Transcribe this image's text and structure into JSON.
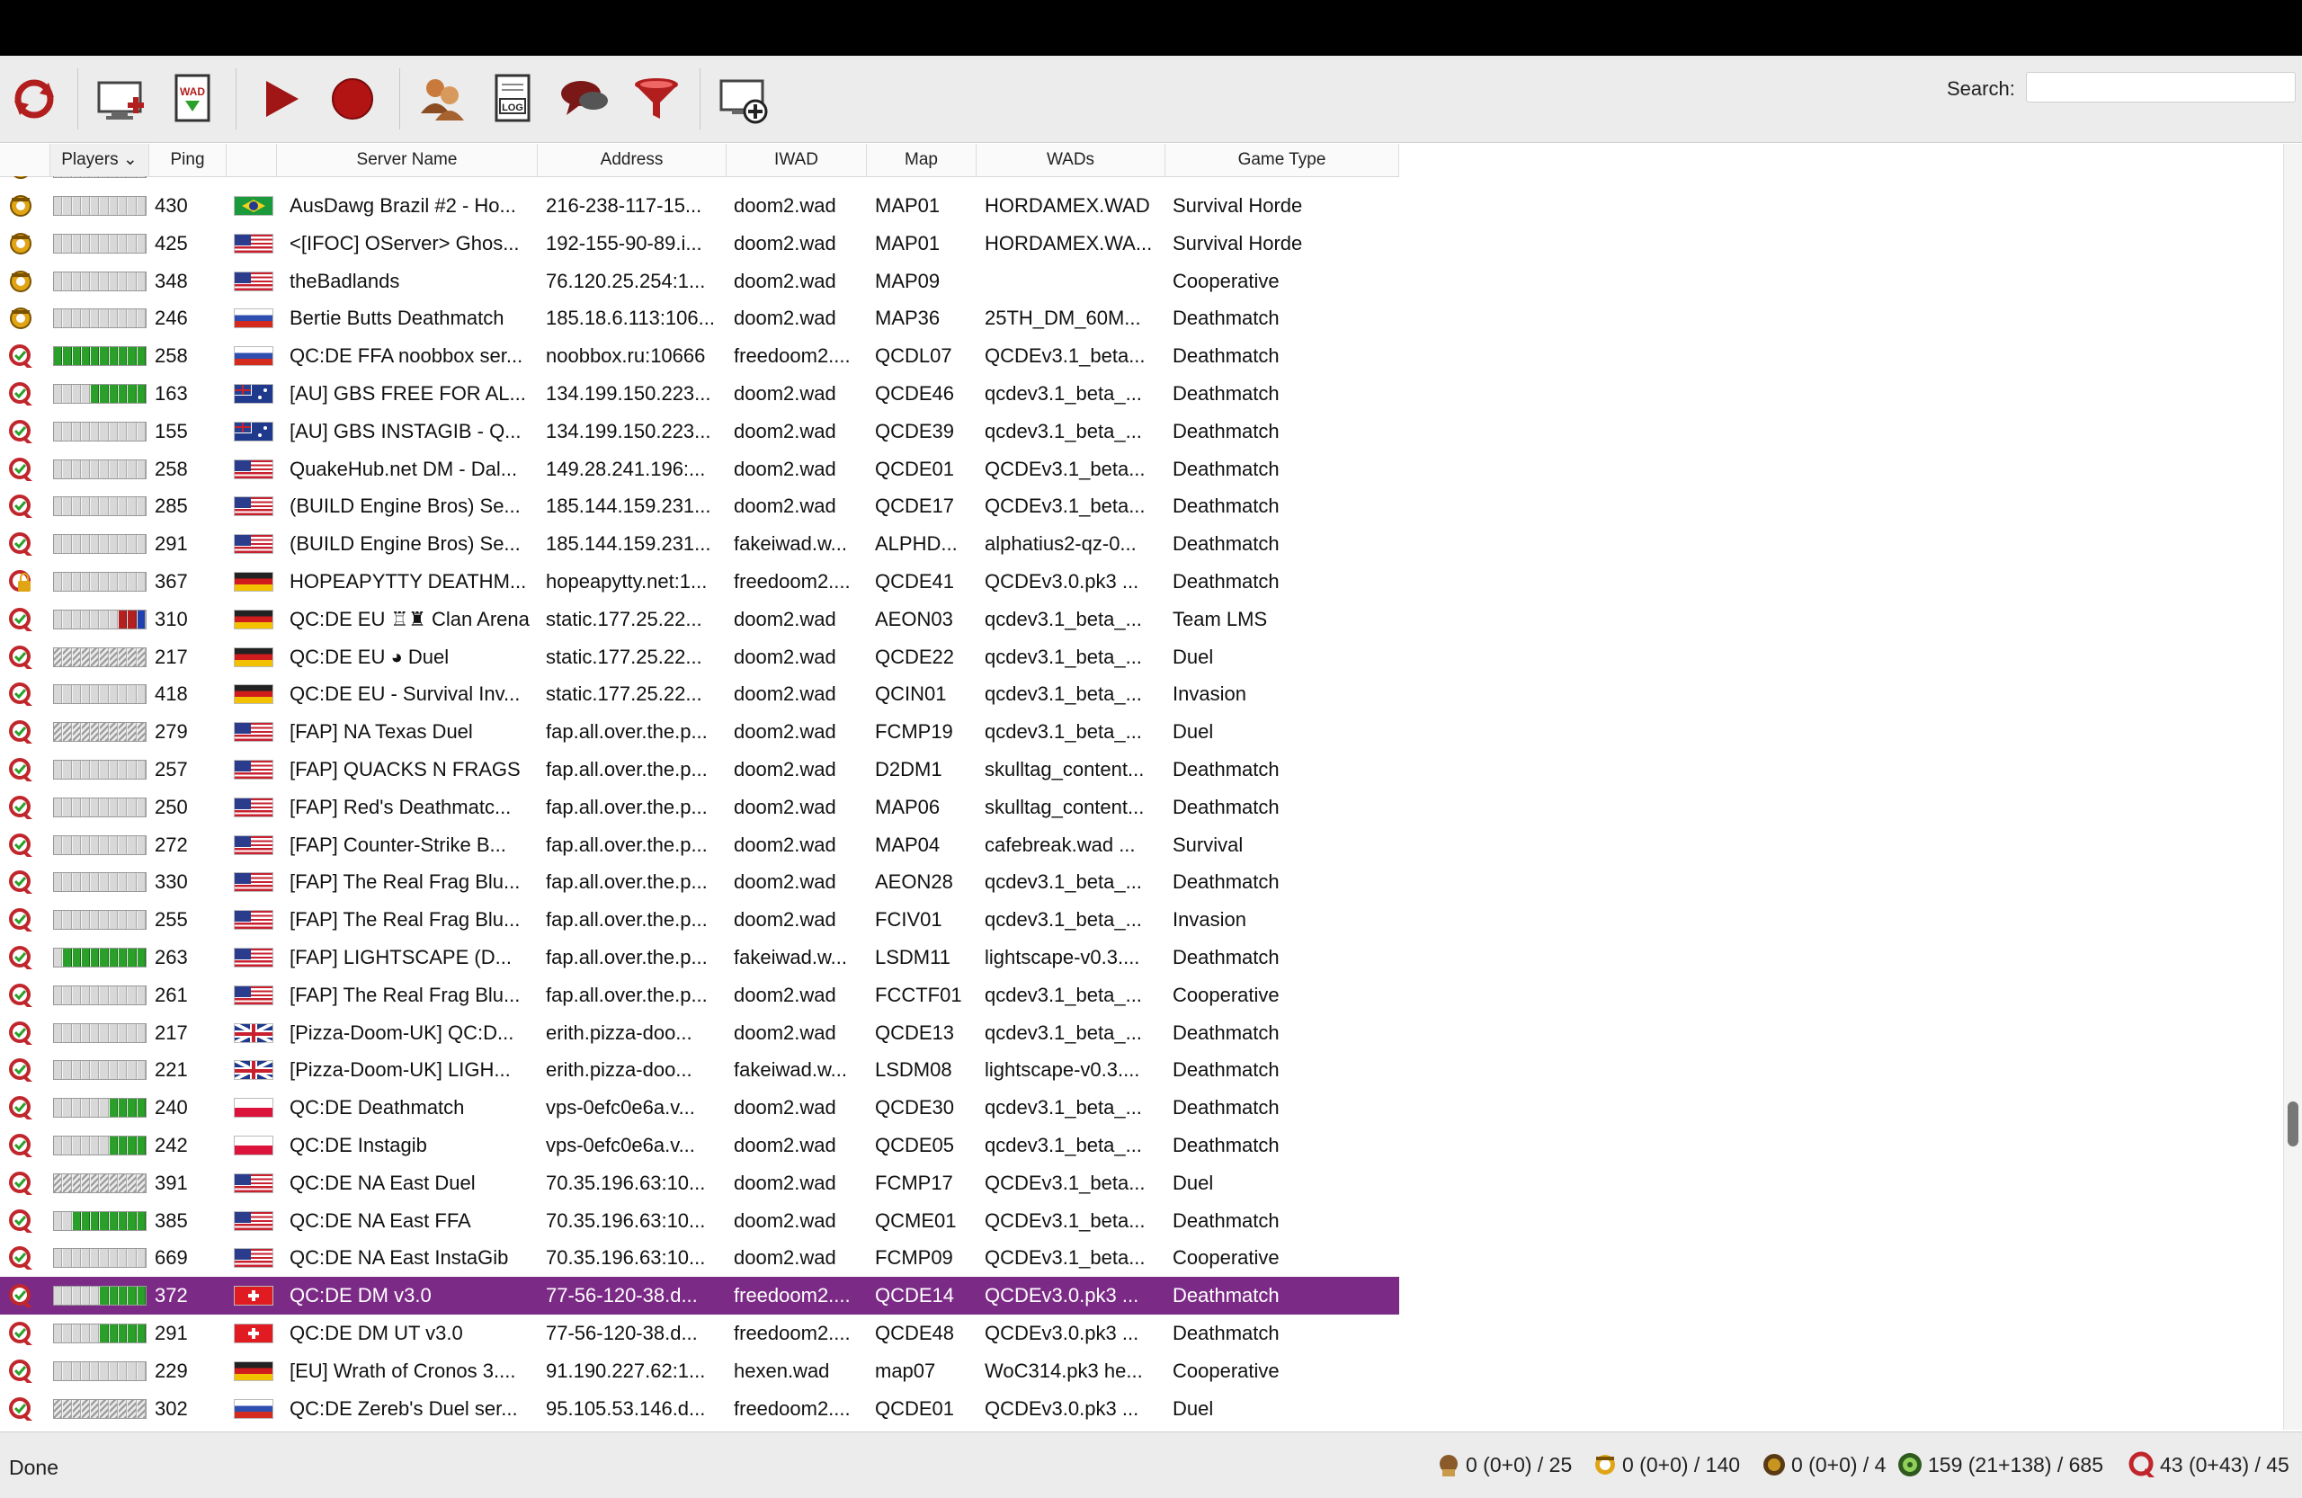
{
  "toolbar": {
    "buttons": [
      {
        "name": "refresh-icon"
      },
      {
        "name": "add-server-icon"
      },
      {
        "name": "wad-download-icon"
      },
      {
        "name": "play-icon"
      },
      {
        "name": "record-icon"
      },
      {
        "name": "players-icon"
      },
      {
        "name": "log-icon"
      },
      {
        "name": "chat-icon"
      },
      {
        "name": "filter-icon"
      },
      {
        "name": "create-server-icon"
      }
    ],
    "wad_label": "WAD",
    "log_label": "LOG",
    "search_label": "Search:",
    "search_value": ""
  },
  "columns": [
    "Players",
    "Ping",
    "Server Name",
    "Address",
    "IWAD",
    "Map",
    "WADs",
    "Game Type"
  ],
  "players_sort_glyph": "⌄",
  "rows": [
    {
      "ping": "430",
      "name": "AusDawg Brazil #2 - Ho...",
      "address": "216-238-117-15...",
      "iwad": "doom2.wad",
      "map": "MAP01",
      "wads": "HORDAMEX.WAD",
      "type": "Survival Horde",
      "flag": "br",
      "icon": "zan",
      "bar": "e"
    },
    {
      "ping": "425",
      "name": "<[IFOC] OServer> Ghos...",
      "address": "192-155-90-89.i...",
      "iwad": "doom2.wad",
      "map": "MAP01",
      "wads": "HORDAMEX.WA...",
      "type": "Survival Horde",
      "flag": "us",
      "icon": "zan",
      "bar": "e"
    },
    {
      "ping": "348",
      "name": "theBadlands",
      "address": "76.120.25.254:1...",
      "iwad": "doom2.wad",
      "map": "MAP09",
      "wads": "",
      "type": "Cooperative",
      "flag": "us",
      "icon": "zan",
      "bar": "e"
    },
    {
      "ping": "246",
      "name": "Bertie Butts Deathmatch",
      "address": "185.18.6.113:106...",
      "iwad": "doom2.wad",
      "map": "MAP36",
      "wads": "25TH_DM_60M...",
      "type": "Deathmatch",
      "flag": "ru",
      "icon": "zan",
      "bar": "e"
    },
    {
      "ping": "258",
      "name": "QC:DE FFA noobbox ser...",
      "address": "noobbox.ru:10666",
      "iwad": "freedoom2....",
      "map": "QCDL07",
      "wads": "QCDEv3.1_beta...",
      "type": "Deathmatch",
      "flag": "ru",
      "icon": "q",
      "bar": "f10"
    },
    {
      "ping": "163",
      "name": "[AU] GBS FREE FOR AL...",
      "address": "134.199.150.223...",
      "iwad": "doom2.wad",
      "map": "QCDE46",
      "wads": "qcdev3.1_beta_...",
      "type": "Deathmatch",
      "flag": "au",
      "icon": "q",
      "bar": "f6"
    },
    {
      "ping": "155",
      "name": "[AU] GBS INSTAGIB - Q...",
      "address": "134.199.150.223...",
      "iwad": "doom2.wad",
      "map": "QCDE39",
      "wads": "qcdev3.1_beta_...",
      "type": "Deathmatch",
      "flag": "au",
      "icon": "q",
      "bar": "e"
    },
    {
      "ping": "258",
      "name": "QuakeHub.net DM - Dal...",
      "address": "149.28.241.196:...",
      "iwad": "doom2.wad",
      "map": "QCDE01",
      "wads": "QCDEv3.1_beta...",
      "type": "Deathmatch",
      "flag": "us",
      "icon": "q",
      "bar": "e"
    },
    {
      "ping": "285",
      "name": "(BUILD Engine Bros) Se...",
      "address": "185.144.159.231...",
      "iwad": "doom2.wad",
      "map": "QCDE17",
      "wads": "QCDEv3.1_beta...",
      "type": "Deathmatch",
      "flag": "us",
      "icon": "q",
      "bar": "e"
    },
    {
      "ping": "291",
      "name": "(BUILD Engine Bros) Se...",
      "address": "185.144.159.231...",
      "iwad": "fakeiwad.w...",
      "map": "ALPHD...",
      "wads": "alphatius2-qz-0...",
      "type": "Deathmatch",
      "flag": "us",
      "icon": "q",
      "bar": "e"
    },
    {
      "ping": "367",
      "name": "HOPEAPYTTY DEATHM...",
      "address": "hopeapytty.net:1...",
      "iwad": "freedoom2....",
      "map": "QCDE41",
      "wads": "QCDEv3.0.pk3 ...",
      "type": "Deathmatch",
      "flag": "de",
      "icon": "lock",
      "bar": "e"
    },
    {
      "ping": "310",
      "name": "QC:DE EU ♖♜ Clan Arena",
      "address": "static.177.25.22...",
      "iwad": "doom2.wad",
      "map": "AEON03",
      "wads": "qcdev3.1_beta_...",
      "type": "Team LMS",
      "flag": "de",
      "icon": "q",
      "bar": "rb"
    },
    {
      "ping": "217",
      "name": "QC:DE EU ◕ Duel",
      "address": "static.177.25.22...",
      "iwad": "doom2.wad",
      "map": "QCDE22",
      "wads": "qcdev3.1_beta_...",
      "type": "Duel",
      "flag": "de",
      "icon": "q",
      "bar": "s"
    },
    {
      "ping": "418",
      "name": "QC:DE EU - Survival Inv...",
      "address": "static.177.25.22...",
      "iwad": "doom2.wad",
      "map": "QCIN01",
      "wads": "qcdev3.1_beta_...",
      "type": "Invasion",
      "flag": "de",
      "icon": "q",
      "bar": "e"
    },
    {
      "ping": "279",
      "name": "[FAP] NA Texas Duel",
      "address": "fap.all.over.the.p...",
      "iwad": "doom2.wad",
      "map": "FCMP19",
      "wads": "qcdev3.1_beta_...",
      "type": "Duel",
      "flag": "us",
      "icon": "q",
      "bar": "s"
    },
    {
      "ping": "257",
      "name": "[FAP] QUACKS N FRAGS",
      "address": "fap.all.over.the.p...",
      "iwad": "doom2.wad",
      "map": "D2DM1",
      "wads": "skulltag_content...",
      "type": "Deathmatch",
      "flag": "us",
      "icon": "q",
      "bar": "e"
    },
    {
      "ping": "250",
      "name": "[FAP] Red's Deathmatc...",
      "address": "fap.all.over.the.p...",
      "iwad": "doom2.wad",
      "map": "MAP06",
      "wads": "skulltag_content...",
      "type": "Deathmatch",
      "flag": "us",
      "icon": "q",
      "bar": "e"
    },
    {
      "ping": "272",
      "name": "[FAP] Counter-Strike B...",
      "address": "fap.all.over.the.p...",
      "iwad": "doom2.wad",
      "map": "MAP04",
      "wads": "cafebreak.wad ...",
      "type": "Survival",
      "flag": "us",
      "icon": "q",
      "bar": "e"
    },
    {
      "ping": "330",
      "name": "[FAP] The Real Frag Blu...",
      "address": "fap.all.over.the.p...",
      "iwad": "doom2.wad",
      "map": "AEON28",
      "wads": "qcdev3.1_beta_...",
      "type": "Deathmatch",
      "flag": "us",
      "icon": "q",
      "bar": "e"
    },
    {
      "ping": "255",
      "name": "[FAP] The Real Frag Blu...",
      "address": "fap.all.over.the.p...",
      "iwad": "doom2.wad",
      "map": "FCIV01",
      "wads": "qcdev3.1_beta_...",
      "type": "Invasion",
      "flag": "us",
      "icon": "q",
      "bar": "e"
    },
    {
      "ping": "263",
      "name": "[FAP] LIGHTSCAPE (D...",
      "address": "fap.all.over.the.p...",
      "iwad": "fakeiwad.w...",
      "map": "LSDM11",
      "wads": "lightscape-v0.3....",
      "type": "Deathmatch",
      "flag": "us",
      "icon": "q",
      "bar": "f9"
    },
    {
      "ping": "261",
      "name": "[FAP] The Real Frag Blu...",
      "address": "fap.all.over.the.p...",
      "iwad": "doom2.wad",
      "map": "FCCTF01",
      "wads": "qcdev3.1_beta_...",
      "type": "Cooperative",
      "flag": "us",
      "icon": "q",
      "bar": "e"
    },
    {
      "ping": "217",
      "name": "[Pizza-Doom-UK] QC:D...",
      "address": "erith.pizza-doo...",
      "iwad": "doom2.wad",
      "map": "QCDE13",
      "wads": "qcdev3.1_beta_...",
      "type": "Deathmatch",
      "flag": "gb",
      "icon": "q",
      "bar": "e"
    },
    {
      "ping": "221",
      "name": "[Pizza-Doom-UK] LIGH...",
      "address": "erith.pizza-doo...",
      "iwad": "fakeiwad.w...",
      "map": "LSDM08",
      "wads": "lightscape-v0.3....",
      "type": "Deathmatch",
      "flag": "gb",
      "icon": "q",
      "bar": "e"
    },
    {
      "ping": "240",
      "name": "QC:DE Deathmatch",
      "address": "vps-0efc0e6a.v...",
      "iwad": "doom2.wad",
      "map": "QCDE30",
      "wads": "qcdev3.1_beta_...",
      "type": "Deathmatch",
      "flag": "pl",
      "icon": "q",
      "bar": "f4"
    },
    {
      "ping": "242",
      "name": "QC:DE Instagib",
      "address": "vps-0efc0e6a.v...",
      "iwad": "doom2.wad",
      "map": "QCDE05",
      "wads": "qcdev3.1_beta_...",
      "type": "Deathmatch",
      "flag": "pl",
      "icon": "q",
      "bar": "f4"
    },
    {
      "ping": "391",
      "name": "QC:DE NA East Duel",
      "address": "70.35.196.63:10...",
      "iwad": "doom2.wad",
      "map": "FCMP17",
      "wads": "QCDEv3.1_beta...",
      "type": "Duel",
      "flag": "us",
      "icon": "q",
      "bar": "s"
    },
    {
      "ping": "385",
      "name": "QC:DE NA East FFA",
      "address": "70.35.196.63:10...",
      "iwad": "doom2.wad",
      "map": "QCME01",
      "wads": "QCDEv3.1_beta...",
      "type": "Deathmatch",
      "flag": "us",
      "icon": "q",
      "bar": "f8"
    },
    {
      "ping": "669",
      "name": "QC:DE NA East InstaGib",
      "address": "70.35.196.63:10...",
      "iwad": "doom2.wad",
      "map": "FCMP09",
      "wads": "QCDEv3.1_beta...",
      "type": "Cooperative",
      "flag": "us",
      "icon": "q",
      "bar": "e"
    },
    {
      "ping": "372",
      "name": "QC:DE DM v3.0",
      "address": "77-56-120-38.d...",
      "iwad": "freedoom2....",
      "map": "QCDE14",
      "wads": "QCDEv3.0.pk3 ...",
      "type": "Deathmatch",
      "flag": "ch",
      "icon": "q",
      "bar": "f5",
      "selected": true
    },
    {
      "ping": "291",
      "name": "QC:DE DM UT v3.0",
      "address": "77-56-120-38.d...",
      "iwad": "freedoom2....",
      "map": "QCDE48",
      "wads": "QCDEv3.0.pk3 ...",
      "type": "Deathmatch",
      "flag": "ch",
      "icon": "q",
      "bar": "f5"
    },
    {
      "ping": "229",
      "name": "[EU] Wrath of Cronos 3....",
      "address": "91.190.227.62:1...",
      "iwad": "hexen.wad",
      "map": "map07",
      "wads": "WoC314.pk3 he...",
      "type": "Cooperative",
      "flag": "de",
      "icon": "q",
      "bar": "e"
    },
    {
      "ping": "302",
      "name": "QC:DE Zereb's Duel ser...",
      "address": "95.105.53.146.d...",
      "iwad": "freedoom2....",
      "map": "QCDE01",
      "wads": "QCDEv3.0.pk3 ...",
      "type": "Duel",
      "flag": "ru",
      "icon": "q",
      "bar": "s"
    }
  ],
  "status": {
    "text": "Done",
    "counts": [
      {
        "icon": "odamex-icon",
        "text": "0 (0+0) / 25"
      },
      {
        "icon": "zandronum-icon",
        "text": "0 (0+0) / 140"
      },
      {
        "icon": "chocolate-icon",
        "text": "0 (0+0) / 4"
      },
      {
        "icon": "zdaemon-icon",
        "text": "159 (21+138) / 685"
      },
      {
        "icon": "qzandronum-icon",
        "text": "43 (0+43) / 45"
      }
    ]
  },
  "colors": {
    "selection": "#7b2a86",
    "q_icon": "#c0262b",
    "ok_green": "#2aa02a"
  }
}
